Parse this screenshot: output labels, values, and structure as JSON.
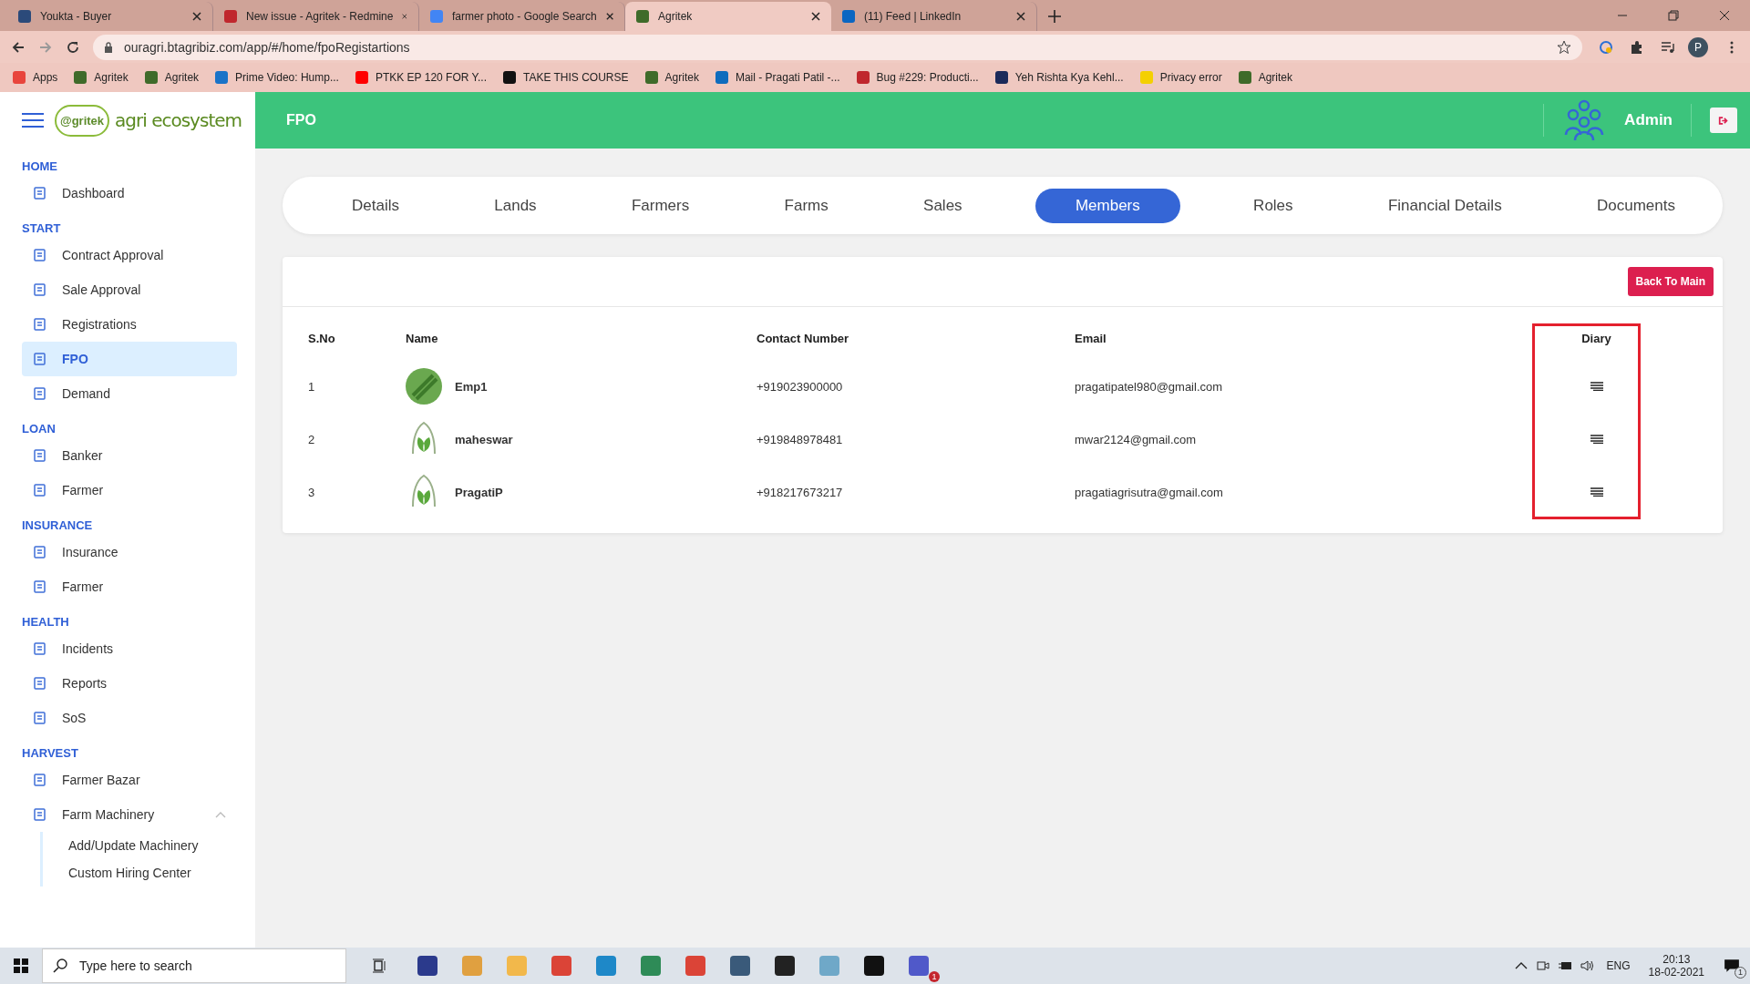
{
  "browser": {
    "tabs": [
      {
        "title": "Youkta - Buyer",
        "color": "#2b4a7a",
        "selected": false
      },
      {
        "title": "New issue - Agritek - Redmine",
        "color": "#c0272d",
        "selected": false
      },
      {
        "title": "farmer photo - Google Search",
        "color": "#4285f4",
        "selected": false
      },
      {
        "title": "Agritek",
        "color": "#3f6b2a",
        "selected": true
      },
      {
        "title": "(11) Feed | LinkedIn",
        "color": "#0a66c2",
        "selected": false
      }
    ],
    "url": "ouragri.btagribiz.com/app/#/home/fpoRegistartions",
    "profile": "P",
    "bookmarks": [
      {
        "label": "Apps",
        "color": "#e8453c"
      },
      {
        "label": "Agritek",
        "color": "#3f6b2a"
      },
      {
        "label": "Agritek",
        "color": "#3f6b2a"
      },
      {
        "label": "Prime Video: Hump...",
        "color": "#1a73c8"
      },
      {
        "label": "PTKK EP 120 FOR Y...",
        "color": "#ff0000"
      },
      {
        "label": "TAKE THIS COURSE",
        "color": "#111111"
      },
      {
        "label": "Agritek",
        "color": "#3f6b2a"
      },
      {
        "label": "Mail - Pragati Patil -...",
        "color": "#0f6cbd"
      },
      {
        "label": "Bug #229: Producti...",
        "color": "#c0272d"
      },
      {
        "label": "Yeh Rishta Kya Kehl...",
        "color": "#1b2a5a"
      },
      {
        "label": "Privacy error",
        "color": "#f4d000"
      },
      {
        "label": "Agritek",
        "color": "#3f6b2a"
      }
    ]
  },
  "logo": {
    "mark": "@gritek",
    "text": "agri ecosystem"
  },
  "header": {
    "title": "FPO",
    "user": "Admin"
  },
  "sidebar": [
    {
      "heading": "HOME",
      "items": [
        {
          "label": "Dashboard",
          "selected": false
        }
      ]
    },
    {
      "heading": "START",
      "items": [
        {
          "label": "Contract Approval",
          "selected": false
        },
        {
          "label": "Sale Approval",
          "selected": false
        },
        {
          "label": "Registrations",
          "selected": false
        },
        {
          "label": "FPO",
          "selected": true
        },
        {
          "label": "Demand",
          "selected": false
        }
      ]
    },
    {
      "heading": "LOAN",
      "items": [
        {
          "label": "Banker",
          "selected": false
        },
        {
          "label": "Farmer",
          "selected": false
        }
      ]
    },
    {
      "heading": "INSURANCE",
      "items": [
        {
          "label": "Insurance",
          "selected": false
        },
        {
          "label": "Farmer",
          "selected": false
        }
      ]
    },
    {
      "heading": "HEALTH",
      "items": [
        {
          "label": "Incidents",
          "selected": false
        },
        {
          "label": "Reports",
          "selected": false
        },
        {
          "label": "SoS",
          "selected": false
        }
      ]
    },
    {
      "heading": "HARVEST",
      "items": [
        {
          "label": "Farmer Bazar",
          "selected": false
        },
        {
          "label": "Farm Machinery",
          "selected": false,
          "expanded": true,
          "children": [
            {
              "label": "Add/Update Machinery"
            },
            {
              "label": "Custom Hiring Center"
            }
          ]
        }
      ]
    }
  ],
  "tabs": [
    {
      "label": "Details",
      "selected": false
    },
    {
      "label": "Lands",
      "selected": false
    },
    {
      "label": "Farmers",
      "selected": false
    },
    {
      "label": "Farms",
      "selected": false
    },
    {
      "label": "Sales",
      "selected": false
    },
    {
      "label": "Members",
      "selected": true
    },
    {
      "label": "Roles",
      "selected": false
    },
    {
      "label": "Financial Details",
      "selected": false
    },
    {
      "label": "Documents",
      "selected": false
    }
  ],
  "back_button": "Back To Main",
  "table": {
    "columns": [
      "S.No",
      "Name",
      "Contact Number",
      "Email",
      "Diary"
    ],
    "rows": [
      {
        "sno": "1",
        "kind": "photo",
        "name": "Emp1",
        "contact": "+919023900000",
        "email": "pragatipatel980@gmail.com"
      },
      {
        "sno": "2",
        "kind": "logo",
        "name": "maheswar",
        "contact": "+919848978481",
        "email": "mwar2124@gmail.com"
      },
      {
        "sno": "3",
        "kind": "logo",
        "name": "PragatiP",
        "contact": "+918217673217",
        "email": "pragatiagrisutra@gmail.com"
      }
    ]
  },
  "taskbar": {
    "search_placeholder": "Type here to search",
    "apps": [
      {
        "color": "#2b3a8c"
      },
      {
        "color": "#e0a040"
      },
      {
        "color": "#f2b84b"
      },
      {
        "color": "#db4437"
      },
      {
        "color": "#1e88c8"
      },
      {
        "color": "#2e8b57"
      },
      {
        "color": "#db4437"
      },
      {
        "color": "#3a5a7a"
      },
      {
        "color": "#222222"
      },
      {
        "color": "#6fa8c8"
      },
      {
        "color": "#111111"
      },
      {
        "color": "#5059c9"
      }
    ],
    "teams_badge": "1",
    "language": "ENG",
    "time": "20:13",
    "date": "18-02-2021",
    "notifications": "1"
  }
}
